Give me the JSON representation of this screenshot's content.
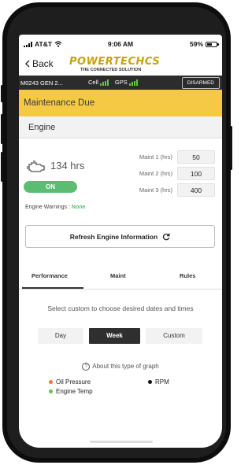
{
  "status_bar": {
    "carrier": "AT&T",
    "time": "9:06 AM",
    "battery_pct": "59%",
    "battery_level": 0.59
  },
  "nav": {
    "back_label": "Back",
    "logo_main": "POWERTECHCS",
    "logo_sub": "THE CONNECTED SOLUTION"
  },
  "device_bar": {
    "device_name": "M0243 GEN 2...",
    "cell_label": "Cell",
    "gps_label": "GPS",
    "arm_status": "DISARMED"
  },
  "banner": {
    "text": "Maintenance Due",
    "color": "#f5c944"
  },
  "engine": {
    "section_title": "Engine",
    "hours": "134 hrs",
    "state_label": "ON",
    "state_color": "#5cbd72",
    "maintenance": [
      {
        "label": "Maint 1 (hrs)",
        "value": "50"
      },
      {
        "label": "Maint 2 (hrs)",
        "value": "100"
      },
      {
        "label": "Maint 3 (hrs)",
        "value": "400"
      }
    ],
    "warnings_label": "Engine Warnings :",
    "warnings_value": "None"
  },
  "refresh_button": "Refresh Engine Information",
  "tabs": [
    {
      "label": "Performance",
      "active": true
    },
    {
      "label": "Maint",
      "active": false
    },
    {
      "label": "Rules",
      "active": false
    }
  ],
  "performance": {
    "hint": "Select custom to choose desired dates and times",
    "ranges": [
      {
        "label": "Day",
        "active": false
      },
      {
        "label": "Week",
        "active": true
      },
      {
        "label": "Custom",
        "active": false
      }
    ],
    "about_link": "About this type of graph",
    "legend": [
      {
        "label": "Oil Pressure",
        "color": "#f07830"
      },
      {
        "label": "RPM",
        "color": "#111111"
      },
      {
        "label": "Engine Temp",
        "color": "#6cc04a"
      }
    ]
  }
}
